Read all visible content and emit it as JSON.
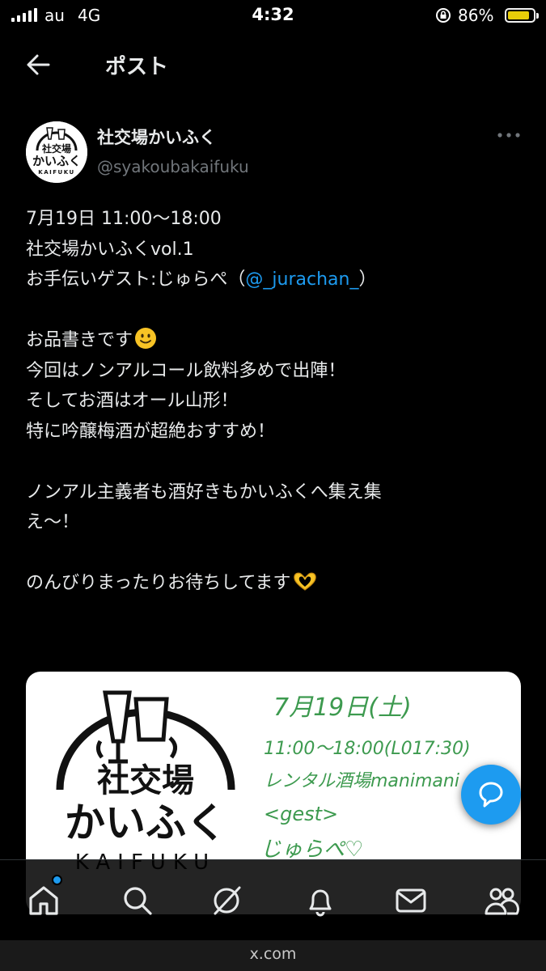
{
  "status_bar": {
    "carrier": "au",
    "network": "4G",
    "time": "4:32",
    "battery": "86%",
    "battery_level": 0.86
  },
  "header": {
    "title": "ポスト"
  },
  "post": {
    "display_name": "社交場かいふく",
    "handle": "@syakoubakaifuku",
    "lines": [
      {
        "text": "7月19日 11:00〜18:00"
      },
      {
        "text": "社交場かいふくvol.1"
      },
      {
        "text": "お手伝いゲスト:じゅらぺ（",
        "mention": "@_jurachan_",
        "after": "）"
      },
      {
        "blank": true
      },
      {
        "text": "お品書きです",
        "emoji": "slightly-smiling-face"
      },
      {
        "text": "今回はノンアルコール飲料多めで出陣！"
      },
      {
        "text": "そしてお酒はオール山形！"
      },
      {
        "text": "特に吟醸梅酒が超絶おすすめ！"
      },
      {
        "blank": true
      },
      {
        "text": "ノンアル主義者も酒好きもかいふくへ集え集"
      },
      {
        "text": "え〜！"
      },
      {
        "blank": true
      },
      {
        "text": "のんびりまったりお待ちしてます",
        "emoji": "heart-hands"
      }
    ]
  },
  "media": {
    "logo": {
      "line1": "社交場",
      "line2": "かいふく",
      "line3": "KAIFUKU"
    },
    "avatar_logo": {
      "line1": "社交場",
      "line2": "かいふく",
      "line3": "KAIFUKU"
    },
    "handwritten": [
      "7月19日(土)",
      "11:00〜18:00(L017:30)",
      "レンタル酒場manimani",
      "<gest>",
      "じゅらぺ♡"
    ],
    "accent_color": "#3d9a4f"
  },
  "nav": {
    "items": [
      "home-icon",
      "search-icon",
      "grok-icon",
      "notifications-icon",
      "messages-icon",
      "communities-icon"
    ],
    "active": "home",
    "home_has_badge": true
  },
  "browser": {
    "url": "x.com"
  },
  "colors": {
    "background": "#000000",
    "text": "#e7e9ea",
    "secondary": "#71767b",
    "accent": "#1d9bf0"
  }
}
